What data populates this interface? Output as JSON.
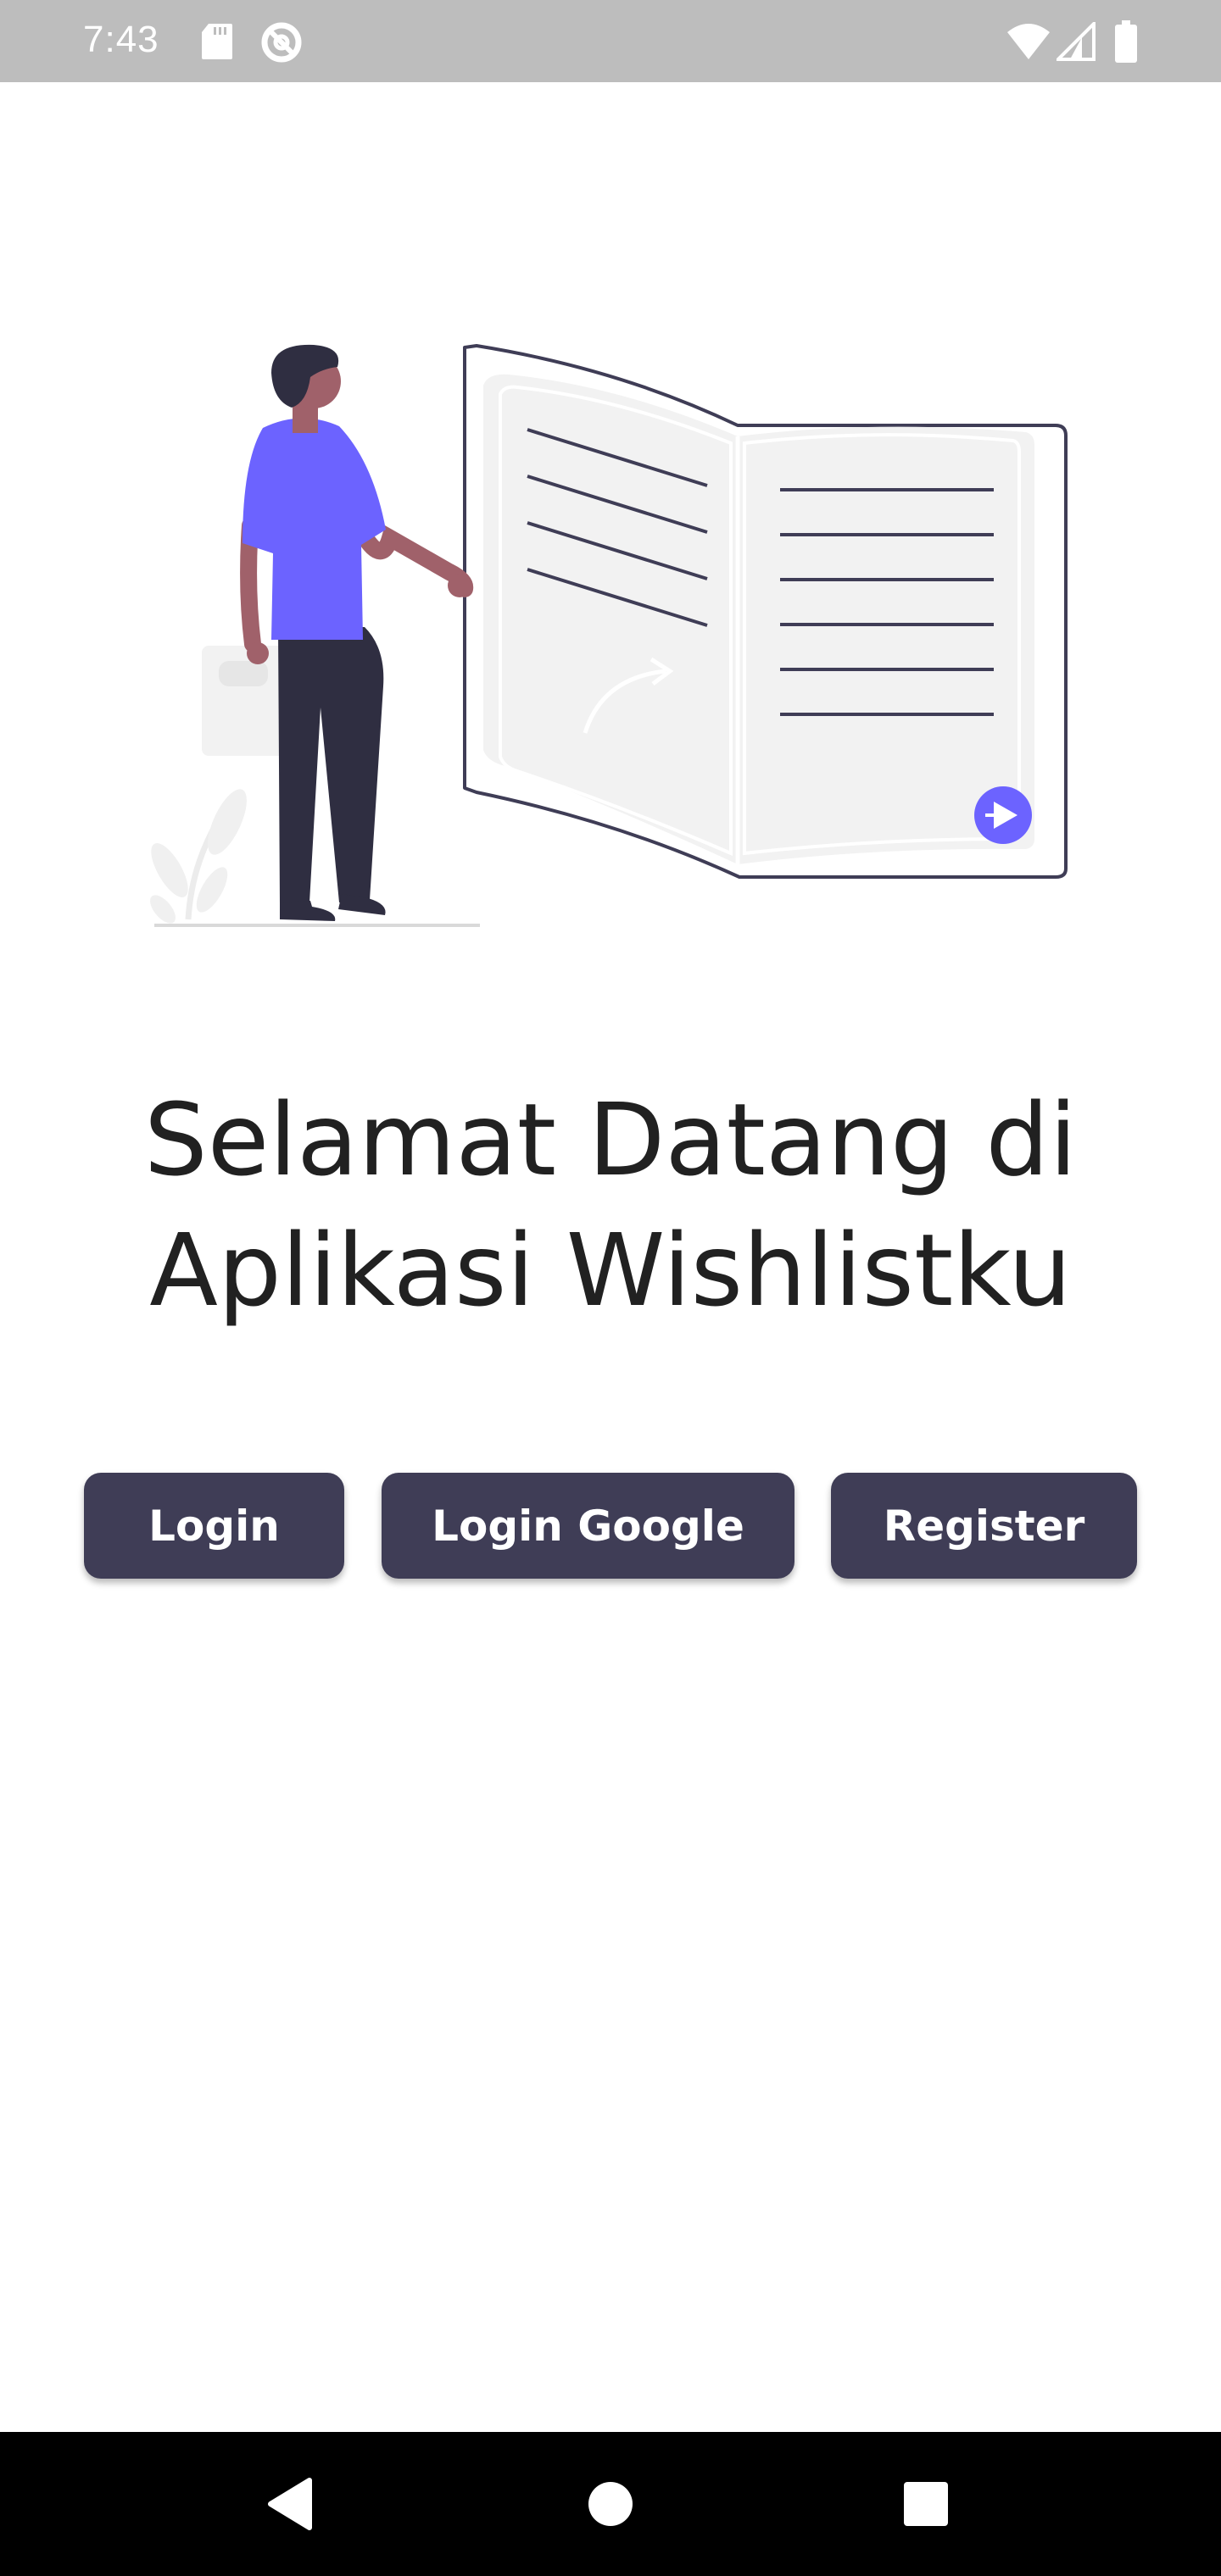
{
  "status_bar": {
    "time": "7:43",
    "icons_left": [
      "sd-card-icon",
      "data-saver-icon"
    ],
    "icons_right": [
      "wifi-icon",
      "signal-icon",
      "battery-icon"
    ],
    "background": "#bdbdbd"
  },
  "welcome": {
    "line1": "Selamat Datang di",
    "line2": "Aplikasi Wishlistku"
  },
  "buttons": {
    "login": "Login",
    "login_google": "Login Google",
    "register": "Register"
  },
  "nav_bar": {
    "icons": [
      "back-icon",
      "home-icon",
      "recents-icon"
    ]
  },
  "colors": {
    "button": "#3f3d56",
    "accent": "#6c63ff",
    "text": "#212121"
  }
}
